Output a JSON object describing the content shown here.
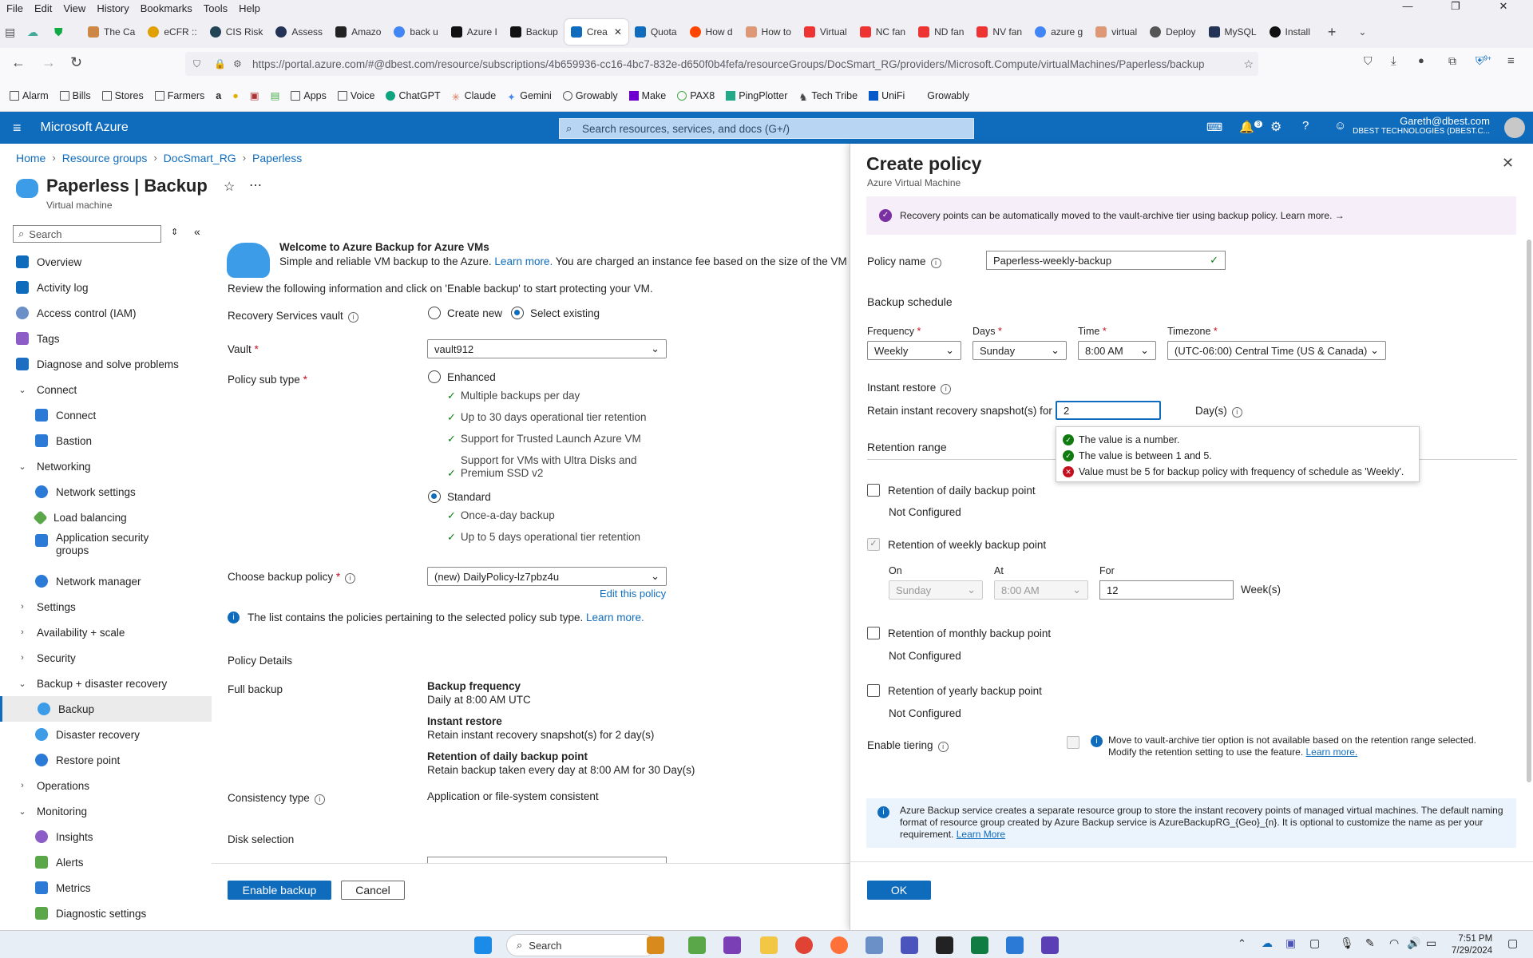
{
  "browser": {
    "menu": [
      "File",
      "Edit",
      "View",
      "History",
      "Bookmarks",
      "Tools",
      "Help"
    ],
    "tabs": [
      "The Ca",
      "eCFR ::",
      "CIS Risk",
      "Assess",
      "Amazo",
      "back u",
      "Azure I",
      "Backup",
      "Crea",
      "Quota",
      "How d",
      "How to",
      "Virtual",
      "NC fan",
      "ND fan",
      "NV fan",
      "azure g",
      "virtual",
      "Deploy",
      "MySQL",
      "Install"
    ],
    "url": "https://portal.azure.com/#@dbest.com/resource/subscriptions/4b659936-cc16-4bc7-832e-d650f0b4fefa/resourceGroups/DocSmart_RG/providers/Microsoft.Compute/virtualMachines/Paperless/backup",
    "bookmarks": [
      "Alarm",
      "Bills",
      "Stores",
      "Farmers",
      "Apps",
      "Voice",
      "ChatGPT",
      "Claude",
      "Gemini",
      "Growably",
      "Make",
      "PAX8",
      "PingPlotter",
      "Tech Tribe",
      "UniFi",
      "Growably"
    ],
    "notification_badge": "9+"
  },
  "azure": {
    "brand": "Microsoft Azure",
    "search_placeholder": "Search resources, services, and docs (G+/)",
    "notif_count": "3",
    "user_email": "Gareth@dbest.com",
    "user_org": "DBEST TECHNOLOGIES (DBEST.C..."
  },
  "breadcrumb": [
    "Home",
    "Resource groups",
    "DocSmart_RG",
    "Paperless"
  ],
  "resource": {
    "title": "Paperless | Backup",
    "subtitle": "Virtual machine"
  },
  "leftnav": {
    "search": "Search",
    "items": [
      {
        "label": "Overview"
      },
      {
        "label": "Activity log"
      },
      {
        "label": "Access control (IAM)"
      },
      {
        "label": "Tags"
      },
      {
        "label": "Diagnose and solve problems"
      },
      {
        "label": "Connect"
      },
      {
        "label": "Connect"
      },
      {
        "label": "Bastion"
      },
      {
        "label": "Networking"
      },
      {
        "label": "Network settings"
      },
      {
        "label": "Load balancing"
      },
      {
        "label": "Application security groups"
      },
      {
        "label": "Network manager"
      },
      {
        "label": "Settings"
      },
      {
        "label": "Availability + scale"
      },
      {
        "label": "Security"
      },
      {
        "label": "Backup + disaster recovery"
      },
      {
        "label": "Backup"
      },
      {
        "label": "Disaster recovery"
      },
      {
        "label": "Restore point"
      },
      {
        "label": "Operations"
      },
      {
        "label": "Monitoring"
      },
      {
        "label": "Insights"
      },
      {
        "label": "Alerts"
      },
      {
        "label": "Metrics"
      },
      {
        "label": "Diagnostic settings"
      }
    ]
  },
  "main": {
    "welcome_title": "Welcome to Azure Backup for Azure VMs",
    "welcome_text": "Simple and reliable VM backup to the Azure.",
    "learn_more": "Learn more.",
    "welcome_fee": "You are charged an instance fee based on the size of the VM and",
    "review_text": "Review the following information and click on 'Enable backup' to start protecting your VM.",
    "vault_label": "Recovery Services vault",
    "create_new": "Create new",
    "select_existing": "Select existing",
    "vault_field_label": "Vault",
    "vault_value": "vault912",
    "policy_sub_type": "Policy sub type",
    "enhanced": "Enhanced",
    "enhanced_features": [
      "Multiple backups per day",
      "Up to 30 days operational tier retention",
      "Support for Trusted Launch Azure VM",
      "Support for VMs with Ultra Disks and",
      "Premium SSD v2"
    ],
    "standard": "Standard",
    "standard_features": [
      "Once-a-day backup",
      "Up to 5 days operational tier retention"
    ],
    "choose_policy": "Choose backup policy",
    "policy_value": "(new) DailyPolicy-lz7pbz4u",
    "edit_policy": "Edit this policy",
    "list_info": "The list contains the policies pertaining to the selected policy sub type.",
    "learn_more2": "Learn more.",
    "policy_details": "Policy Details",
    "full_backup": "Full backup",
    "backup_freq_title": "Backup frequency",
    "backup_freq_value": "Daily at 8:00 AM UTC",
    "instant_restore_title": "Instant restore",
    "instant_restore_value": "Retain instant recovery snapshot(s) for 2 day(s)",
    "retention_daily_title": "Retention of daily backup point",
    "retention_daily_value": "Retain backup taken every day at 8:00 AM for 30 Day(s)",
    "consistency_type": "Consistency type",
    "consistency_value": "Application or file-system consistent",
    "disk_selection": "Disk selection",
    "enable_backup": "Enable backup",
    "cancel": "Cancel"
  },
  "panel": {
    "title": "Create policy",
    "subtitle": "Azure Virtual Machine",
    "banner": "Recovery points can be automatically moved to the vault-archive tier using backup policy.",
    "banner_link": "Learn more.",
    "policy_name_label": "Policy name",
    "policy_name_value": "Paperless-weekly-backup",
    "backup_schedule": "Backup schedule",
    "frequency_label": "Frequency",
    "frequency_value": "Weekly",
    "days_label": "Days",
    "days_value": "Sunday",
    "time_label": "Time",
    "time_value": "8:00 AM",
    "timezone_label": "Timezone",
    "timezone_value": "(UTC-06:00) Central Time (US & Canada)",
    "instant_restore": "Instant restore",
    "retain_label": "Retain instant recovery snapshot(s) for",
    "retain_value": "2",
    "days_unit": "Day(s)",
    "validation": [
      {
        "ok": true,
        "text": "The value is a number."
      },
      {
        "ok": true,
        "text": "The value is between 1 and 5."
      },
      {
        "ok": false,
        "text": "Value must be 5 for backup policy with frequency of schedule as 'Weekly'."
      }
    ],
    "retention_range": "Retention range",
    "ret_daily": "Retention of daily backup point",
    "not_configured": "Not Configured",
    "ret_weekly": "Retention of weekly backup point",
    "on_label": "On",
    "on_value": "Sunday",
    "at_label": "At",
    "at_value": "8:00 AM",
    "for_label": "For",
    "for_value": "12",
    "weeks_unit": "Week(s)",
    "ret_monthly": "Retention of monthly backup point",
    "ret_yearly": "Retention of yearly backup point",
    "enable_tiering": "Enable tiering",
    "tiering_info": "Move to vault-archive tier option is not available based on the retention range selected.",
    "tiering_info2": "Modify the retention setting to use the feature.",
    "tiering_link": "Learn more.",
    "rg_info": "Azure Backup service creates a separate resource group to store the instant recovery points of managed virtual machines. The default naming format of resource group created by Azure Backup service is AzureBackupRG_{Geo}_{n}. It is optional to customize the name as per your requirement.",
    "rg_link": "Learn More",
    "ok": "OK"
  },
  "taskbar": {
    "search": "Search",
    "time": "7:51 PM",
    "date": "7/29/2024"
  },
  "colors": {
    "azure_blue": "#0f6cbd",
    "error": "#c50f1f",
    "success": "#107c10"
  }
}
